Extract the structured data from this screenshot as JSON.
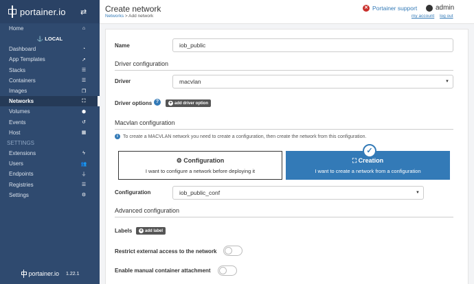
{
  "sidebar": {
    "brand": "portainer.io",
    "endpoint_label": "LOCAL",
    "items": [
      {
        "label": "Home",
        "icon": "home-icon",
        "glyph": "⌂"
      },
      {
        "label": "Dashboard",
        "icon": "dashboard-icon",
        "glyph": "◔"
      },
      {
        "label": "App Templates",
        "icon": "rocket-icon",
        "glyph": "➚"
      },
      {
        "label": "Stacks",
        "icon": "th-list-icon",
        "glyph": "☰"
      },
      {
        "label": "Containers",
        "icon": "server-icon",
        "glyph": "☰"
      },
      {
        "label": "Images",
        "icon": "clone-icon",
        "glyph": "❐"
      },
      {
        "label": "Networks",
        "icon": "sitemap-icon",
        "glyph": "⛶"
      },
      {
        "label": "Volumes",
        "icon": "cubes-icon",
        "glyph": "⬢"
      },
      {
        "label": "Events",
        "icon": "history-icon",
        "glyph": "↺"
      },
      {
        "label": "Host",
        "icon": "th-icon",
        "glyph": "▦"
      }
    ],
    "settings_header": "SETTINGS",
    "settings_items": [
      {
        "label": "Extensions",
        "icon": "bolt-icon",
        "glyph": "ϟ"
      },
      {
        "label": "Users",
        "icon": "users-icon",
        "glyph": "👥"
      },
      {
        "label": "Endpoints",
        "icon": "plug-icon",
        "glyph": "⏚"
      },
      {
        "label": "Registries",
        "icon": "database-icon",
        "glyph": "☰"
      },
      {
        "label": "Settings",
        "icon": "cogs-icon",
        "glyph": "⚙"
      }
    ],
    "footer_brand": "portainer.io",
    "version": "1.22.1"
  },
  "header": {
    "title": "Create network",
    "breadcrumb_link": "Networks",
    "breadcrumb_current": "> Add network",
    "support": "Portainer support",
    "user": "admin",
    "my_account": "my account",
    "log_out": "log out"
  },
  "form": {
    "name_label": "Name",
    "name_value": "iob_public",
    "driver_section": "Driver configuration",
    "driver_label": "Driver",
    "driver_value": "macvlan",
    "driver_options_label": "Driver options",
    "add_driver_option": "add driver option",
    "macvlan_section": "Macvlan configuration",
    "info": "To create a MACVLAN network you need to create a configuration, then create the network from this configuration.",
    "option_config_title": "Configuration",
    "option_config_desc": "I want to configure a network before deploying it",
    "option_creation_title": "Creation",
    "option_creation_desc": "I want to create a network from a configuration",
    "configuration_label": "Configuration",
    "configuration_value": "iob_public_conf",
    "advanced_section": "Advanced configuration",
    "labels_label": "Labels",
    "add_label": "add label",
    "restrict_label": "Restrict external access to the network",
    "restrict_on": false,
    "manual_attach_label": "Enable manual container attachment",
    "manual_attach_on": false
  },
  "colors": {
    "sidebar_bg": "#2f4a6f",
    "accent": "#337ab7",
    "danger": "#c9302c"
  }
}
